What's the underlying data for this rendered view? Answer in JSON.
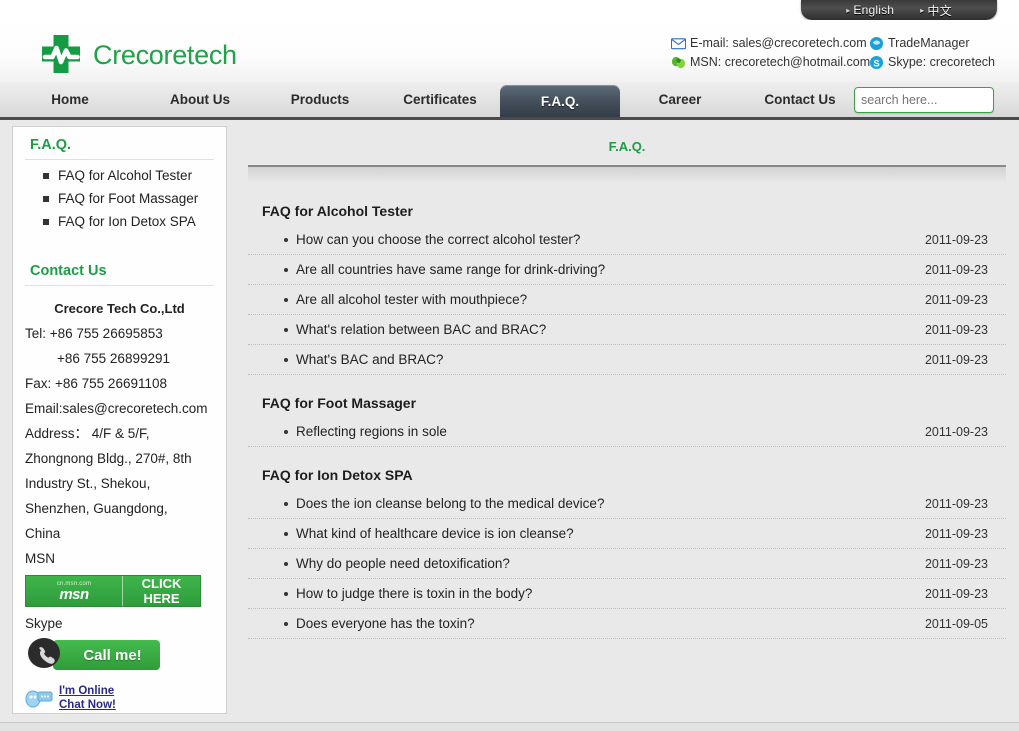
{
  "language_bar": {
    "arrow": "▸",
    "options": [
      {
        "label": "English",
        "selected": true
      },
      {
        "label": "中文",
        "selected": false
      }
    ]
  },
  "header": {
    "brand": "Crecoretech",
    "logo_icon": "green-medical-cross-heartbeat-logo",
    "contacts": [
      {
        "icon": "email-icon",
        "text": "E-mail: sales@crecoretech.com"
      },
      {
        "icon": "tradmanager-icon",
        "text": "TradeManager"
      },
      {
        "icon": "msn-icon",
        "text": "MSN: crecoretech@hotmail.com"
      },
      {
        "icon": "skype-icon",
        "text": "Skype: crecoretech"
      }
    ]
  },
  "nav": {
    "items": [
      {
        "label": "Home",
        "active": false
      },
      {
        "label": "About Us",
        "active": false
      },
      {
        "label": "Products",
        "active": false
      },
      {
        "label": "Certificates",
        "active": false
      },
      {
        "label": "F.A.Q.",
        "active": true
      },
      {
        "label": "Career",
        "active": false
      },
      {
        "label": "Contact Us",
        "active": false
      }
    ]
  },
  "search": {
    "placeholder": "search here...",
    "value": "",
    "button_icon": "magnifier-icon"
  },
  "sidebar": {
    "faq_heading": "F.A.Q.",
    "faq_links": [
      "FAQ for Alcohol Tester",
      "FAQ for Foot Massager",
      "FAQ for Ion Detox SPA"
    ],
    "contact_heading": "Contact Us",
    "company": "Crecore Tech Co.,Ltd",
    "contact_lines": [
      {
        "text": "Tel: +86 755 26695853",
        "style": "plain"
      },
      {
        "text": "+86 755 26899291",
        "style": "indent"
      },
      {
        "text": "Fax: +86 755 26691108",
        "style": "plain"
      },
      {
        "text": "Email:sales@crecoretech.com",
        "style": "plain"
      },
      {
        "text": "Address： 4/F & 5/F,",
        "style": "plain"
      },
      {
        "text": "Zhongnong Bldg., 270#, 8th",
        "style": "plain"
      },
      {
        "text": "Industry St., Shekou,",
        "style": "plain"
      },
      {
        "text": "Shenzhen, Guangdong,",
        "style": "plain"
      },
      {
        "text": "China",
        "style": "plain"
      },
      {
        "text": "MSN",
        "style": "plain"
      }
    ],
    "msn_badge": {
      "domain": "cn.msn.com",
      "wordmark": "msn",
      "action": "CLICK HERE",
      "icon": "msn-butterfly-icon"
    },
    "skype_label": "Skype",
    "skype_button": {
      "label": "Call me!",
      "icon": "skype-phone-icon"
    },
    "chat_link": {
      "line1": "I'm Online",
      "line2": "Chat Now!",
      "icon": "chat-bubble-icon"
    }
  },
  "main": {
    "title": "F.A.Q.",
    "sections": [
      {
        "title": "FAQ for Alcohol Tester",
        "items": [
          {
            "question": "How can you choose the correct alcohol tester?",
            "date": "2011-09-23"
          },
          {
            "question": "Are all countries have same range for drink-driving?",
            "date": "2011-09-23"
          },
          {
            "question": "Are all alcohol tester with mouthpiece?",
            "date": "2011-09-23"
          },
          {
            "question": "What's relation between BAC and BRAC?",
            "date": "2011-09-23"
          },
          {
            "question": "What's BAC and BRAC?",
            "date": "2011-09-23"
          }
        ]
      },
      {
        "title": "FAQ for Foot Massager",
        "items": [
          {
            "question": "Reflecting regions in sole",
            "date": "2011-09-23"
          }
        ]
      },
      {
        "title": "FAQ for Ion Detox SPA",
        "items": [
          {
            "question": "Does the ion cleanse belong to the medical device?",
            "date": "2011-09-23"
          },
          {
            "question": "What kind of healthcare device is ion cleanse?",
            "date": "2011-09-23"
          },
          {
            "question": "Why do people need detoxification?",
            "date": "2011-09-23"
          },
          {
            "question": "How to judge there is toxin in the body?",
            "date": "2011-09-23"
          },
          {
            "question": "Does everyone has the toxin?",
            "date": "2011-09-05"
          }
        ]
      }
    ]
  },
  "colors": {
    "brand_green": "#21a14a",
    "heading_green": "#1f9c46",
    "active_tab": "#46525e",
    "link_blue": "#2a2a8a"
  }
}
